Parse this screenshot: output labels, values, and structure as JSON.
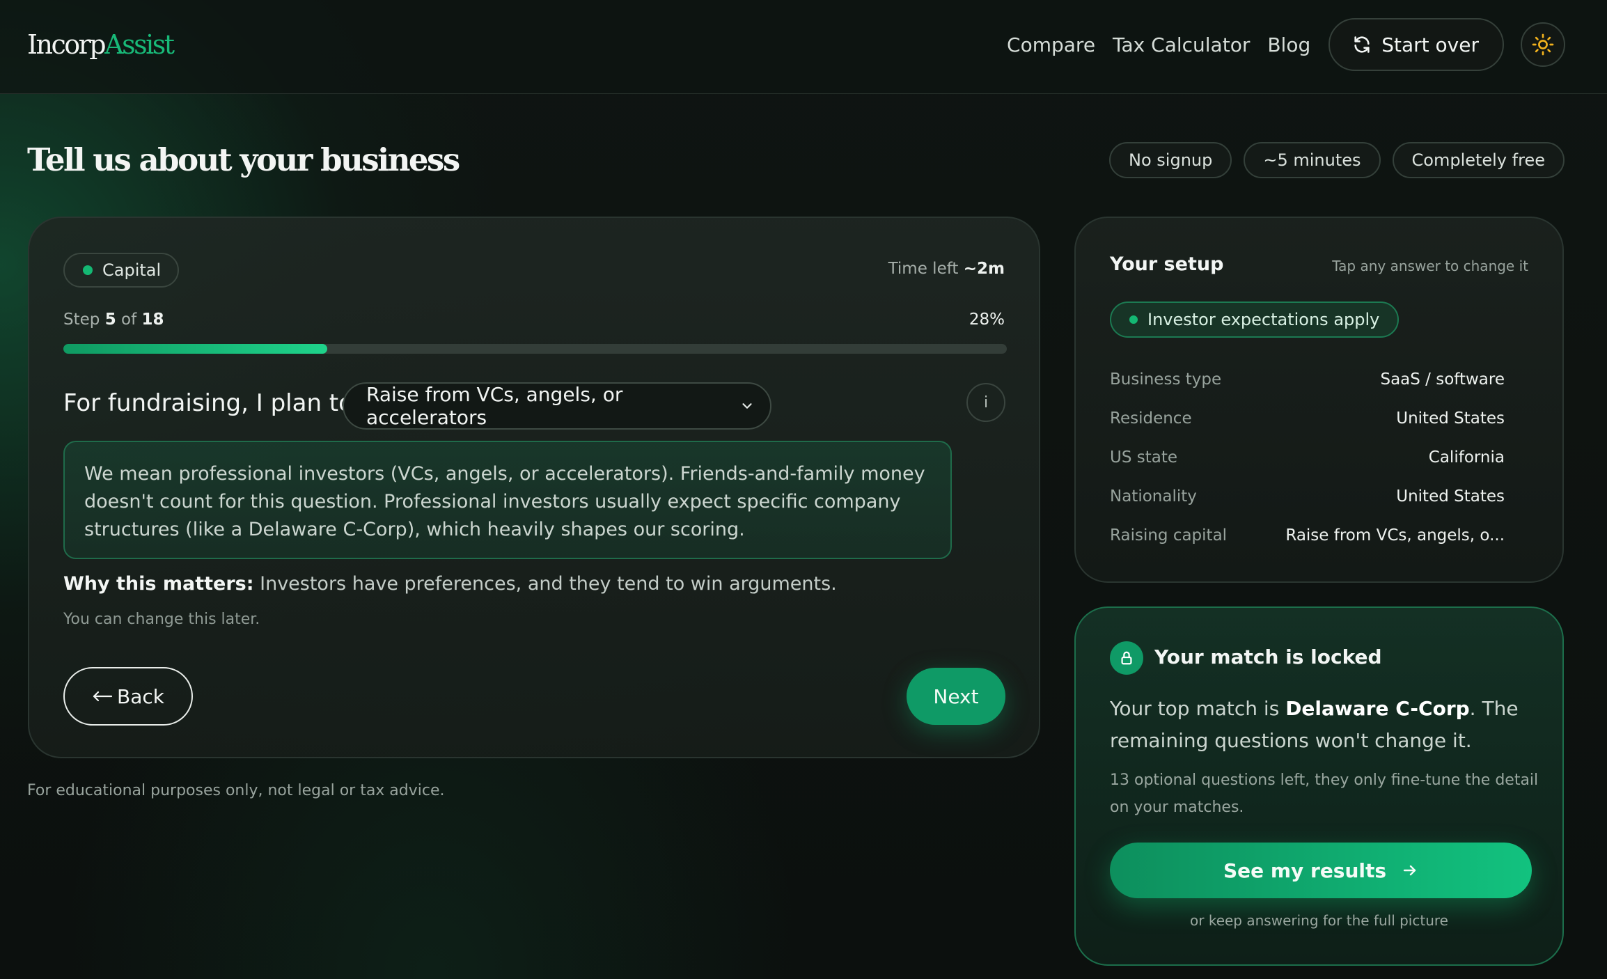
{
  "brand": {
    "name_part1": "Incorp",
    "name_part2": "Assist"
  },
  "nav": {
    "links": [
      "Compare",
      "Tax Calculator",
      "Blog"
    ],
    "start_over": "Start over"
  },
  "page": {
    "title": "Tell us about your business",
    "pills": [
      "No signup",
      "~5 minutes",
      "Completely free"
    ],
    "disclaimer": "For educational purposes only, not legal or tax advice."
  },
  "question_card": {
    "category": "Capital",
    "time_left_label": "Time left",
    "time_left_value": "~2m",
    "step_label": "Step",
    "step_current": "5",
    "step_of": "of",
    "step_total": "18",
    "percent": "28%",
    "progress": 0.28,
    "question": "For fundraising, I plan to",
    "selected_option": "Raise from VCs, angels, or accelerators",
    "info_label": "i",
    "explanation": "We mean professional investors (VCs, angels, or accelerators). Friends-and-family money doesn't count for this question. Professional investors usually expect specific company structures (like a Delaware C-Corp), which heavily shapes our scoring.",
    "why_label": "Why this matters:",
    "why_text": " Investors have preferences, and they tend to win arguments.",
    "change_later": "You can change this later.",
    "back_label": "Back",
    "next_label": "Next"
  },
  "setup": {
    "title": "Your setup",
    "hint": "Tap any answer to change it",
    "badge": "Investor expectations apply",
    "rows": [
      {
        "key": "Business type",
        "value": "SaaS / software"
      },
      {
        "key": "Residence",
        "value": "United States"
      },
      {
        "key": "US state",
        "value": "California"
      },
      {
        "key": "Nationality",
        "value": "United States"
      },
      {
        "key": "Raising capital",
        "value": "Raise from VCs, angels, o..."
      }
    ]
  },
  "locked": {
    "title": "Your match is locked",
    "body_prefix": "Your top match is ",
    "body_match": "Delaware C-Corp",
    "body_suffix": ". The remaining questions won't change it.",
    "note": "13 optional questions left, they only fine-tune the detail on your matches.",
    "cta": "See my results",
    "keep_answering": "or keep answering for the full picture"
  },
  "colors": {
    "accent": "#12b676",
    "background": "#0c0f0d",
    "card": "#1b231f"
  },
  "icons": {
    "start_over": "refresh-icon",
    "theme": "sun-icon",
    "select": "chevron-down-icon",
    "back": "arrow-left-icon",
    "locked": "lock-icon",
    "cta": "arrow-right-icon"
  }
}
